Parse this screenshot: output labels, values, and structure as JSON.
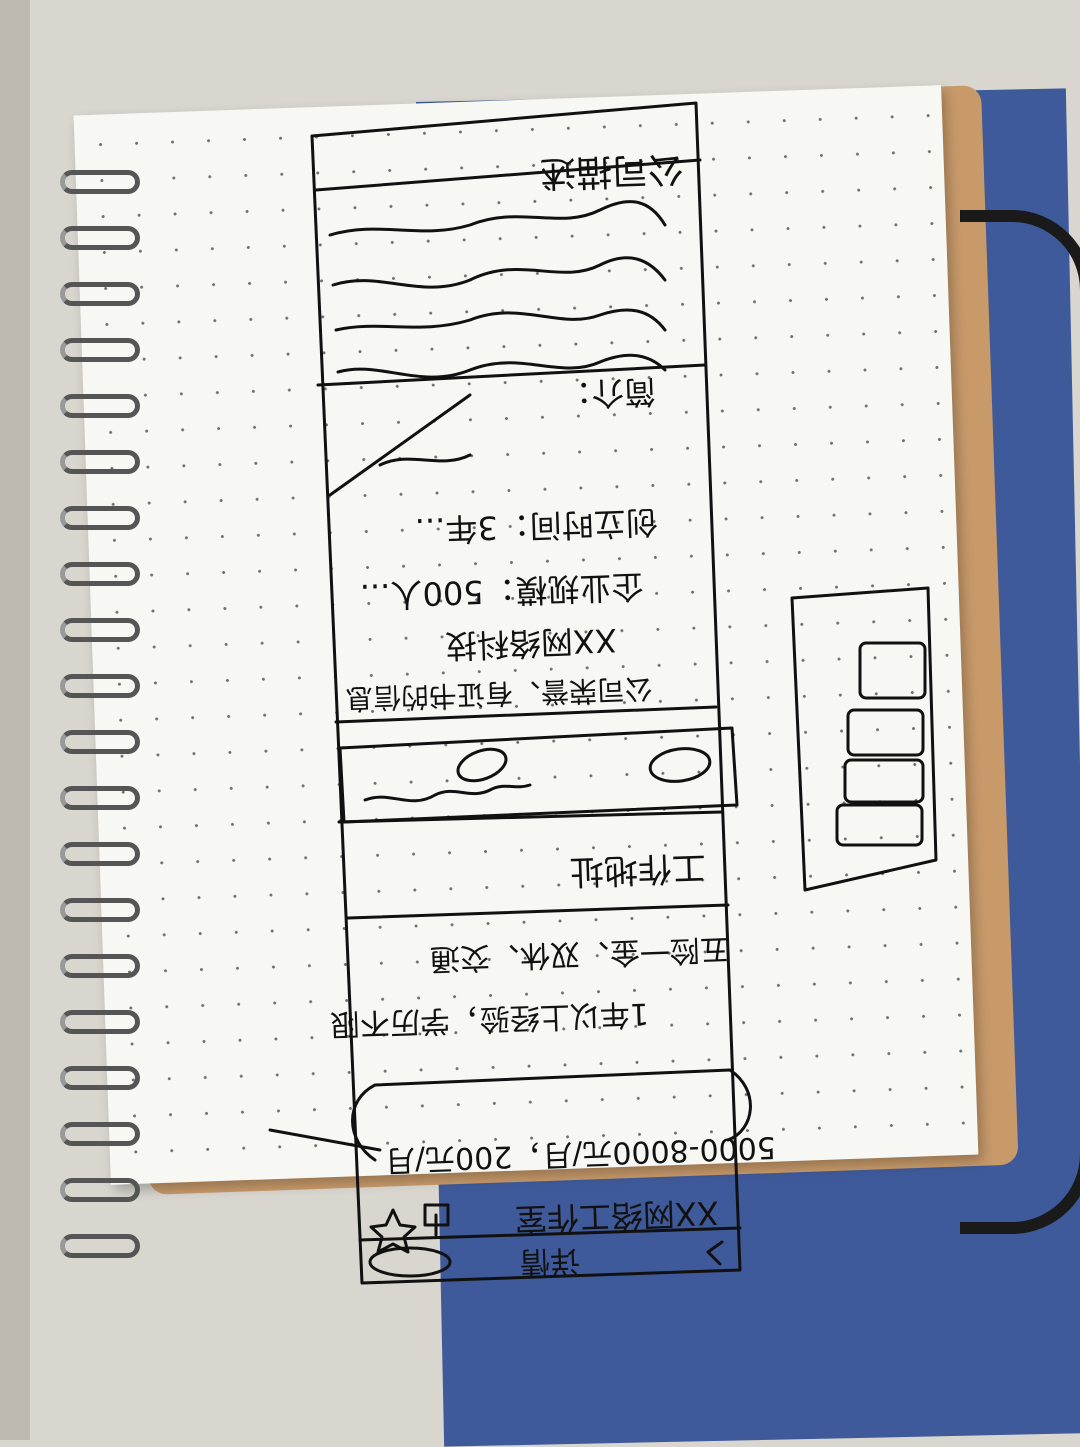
{
  "sketch": {
    "header_title": "公司描述",
    "intro_label": "简介：",
    "scale_label": "企业规模：500人...",
    "founded_label": "创立时间：3年...",
    "honor_label": "公司荣誉、有证书的信息",
    "company_label": "XX网络科技",
    "address_title": "工作地址",
    "job_title": "XX网络工作室",
    "salary": "5000-8000元/月，200元/月",
    "detail_title": "详情",
    "welfare": "1年以上经验，学历不限",
    "tags": "五险一金、双休、交通"
  },
  "colors": {
    "paper": "#f7f7f4",
    "ink": "#111111",
    "blue_cover": "#3f5a9a",
    "board": "#c89a6a"
  },
  "icons": [
    "star-icon",
    "back-chevron-icon",
    "share-icon",
    "eye-icon"
  ]
}
